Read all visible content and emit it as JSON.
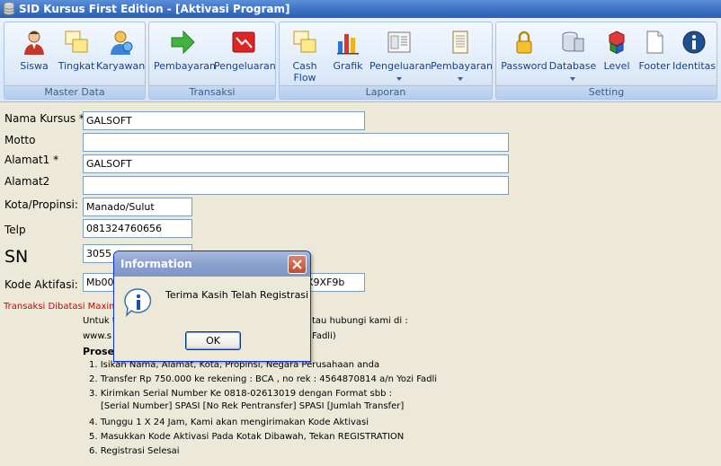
{
  "window": {
    "title": "SID Kursus First Edition - [Aktivasi Program]"
  },
  "ribbon": {
    "groups": [
      {
        "label": "Master Data",
        "buttons": [
          "Siswa",
          "Tingkat",
          "Karyawan"
        ]
      },
      {
        "label": "Transaksi",
        "buttons": [
          "Pembayaran",
          "Pengeluaran"
        ]
      },
      {
        "label": "Laporan",
        "buttons": [
          "Cash Flow",
          "Grafik",
          "Pengeluaran",
          "Pembayaran"
        ]
      },
      {
        "label": "Setting",
        "buttons": [
          "Password",
          "Database",
          "Level",
          "Footer",
          "Identitas"
        ]
      }
    ],
    "cash_flow_line1": "Cash",
    "cash_flow_line2": "Flow"
  },
  "form": {
    "nama_kursus": {
      "label": "Nama Kursus *",
      "value": "GALSOFT"
    },
    "motto": {
      "label": "Motto",
      "value": ""
    },
    "alamat1": {
      "label": "Alamat1 *",
      "value": "GALSOFT"
    },
    "alamat2": {
      "label": "Alamat2",
      "value": ""
    },
    "kota": {
      "label": "Kota/Propinsi:",
      "value": "Manado/Sulut"
    },
    "telp": {
      "label": "Telp",
      "value": "081324760656"
    },
    "sn": {
      "label": "SN",
      "value": "3055"
    },
    "kode_aktifasi": {
      "label": "Kode Aktifasi:",
      "value_left": "Mb009",
      "value_right": "X9XF9b"
    }
  },
  "instructions": {
    "warning": "Transaksi Dibatasi Maxima",
    "intro_left": "Untuk t",
    "intro_right": "tau hubungi kami di :",
    "web_left": "www.s",
    "web_right": "Fadli)",
    "proses_heading": "Prose",
    "steps": [
      "1. Isikan Nama, Alamat, Kota, Propinsi, Negara Perusahaan anda",
      "2. Transfer Rp 750.000 ke rekening : BCA , no rek : 4564870814 a/n Yozi Fadli",
      "3. Kirimkan Serial Number Ke 0818-02613019 dengan Format sbb :",
      "[Serial Number] SPASI [No Rek Pentransfer] SPASI [Jumlah Transfer]",
      "4. Tunggu 1 X 24 Jam, Kami akan mengirimakan Kode Aktivasi",
      "5. Masukkan Kode Aktivasi Pada Kotak Dibawah, Tekan REGISTRATION",
      "6. Registrasi Selesai"
    ]
  },
  "dialog": {
    "title": "Information",
    "message": "Terima Kasih Telah Registrasi",
    "ok_label": "OK"
  }
}
